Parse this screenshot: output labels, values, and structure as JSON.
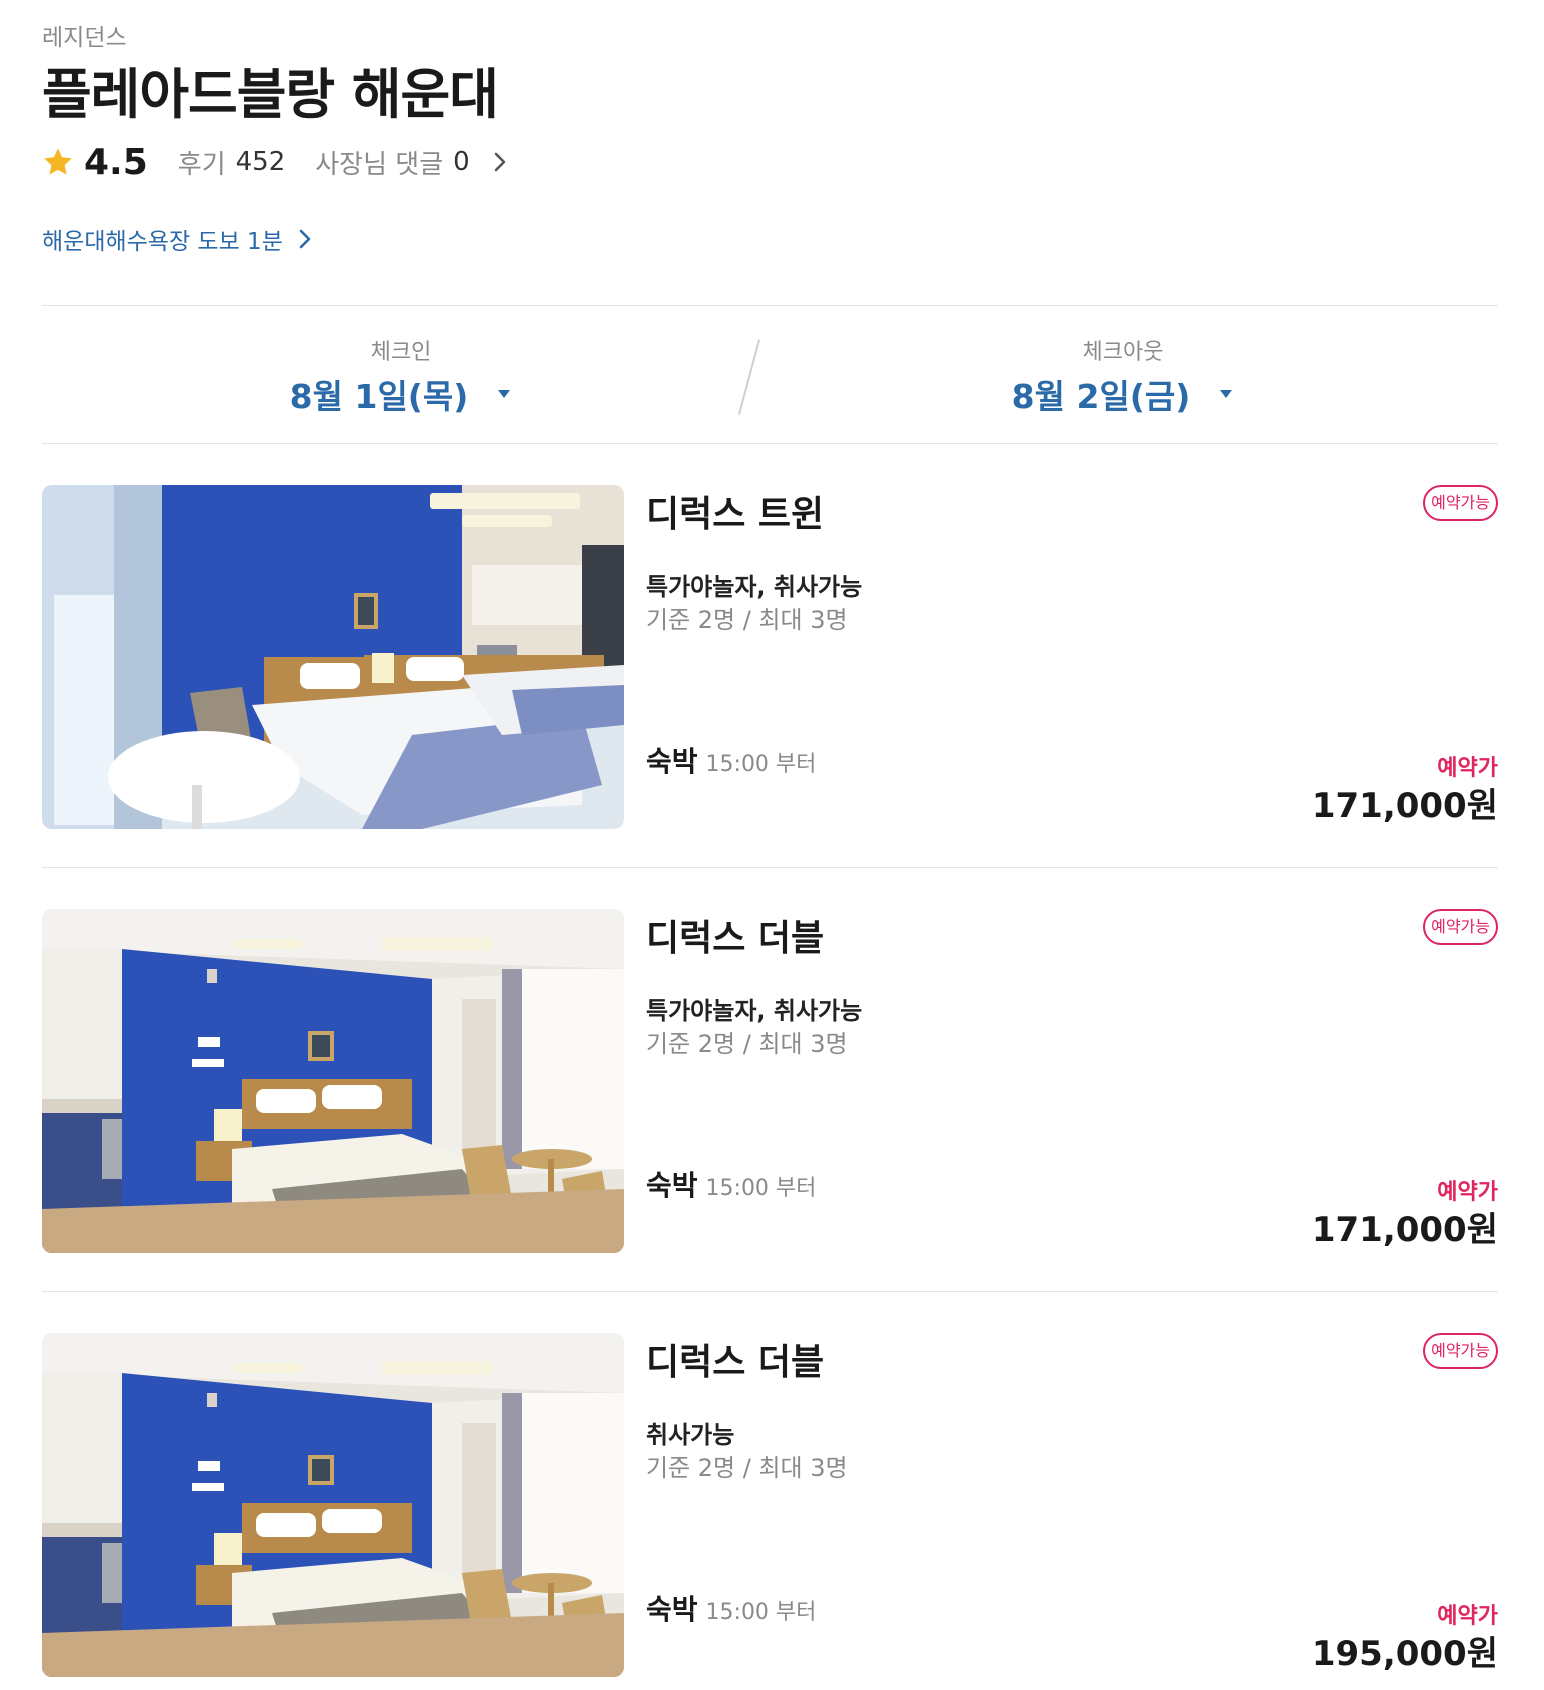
{
  "header": {
    "category": "레지던스",
    "title": "플레아드블랑 해운대",
    "rating": "4.5",
    "review_label": "후기",
    "review_count": "452",
    "owner_reply_label": "사장님 댓글",
    "owner_reply_count": "0",
    "location": "해운대해수욕장 도보 1분"
  },
  "dates": {
    "checkin_label": "체크인",
    "checkin_value": "8월 1일(목)",
    "checkout_label": "체크아웃",
    "checkout_value": "8월 2일(금)"
  },
  "rooms": [
    {
      "name": "디럭스 트윈",
      "badge": "예약가능",
      "features": "특가야놀자, 취사가능",
      "capacity": "기준 2명 / 최대 3명",
      "stay_type": "숙박",
      "stay_time": "15:00 부터",
      "price_label": "예약가",
      "price": "171,000원"
    },
    {
      "name": "디럭스 더블",
      "badge": "예약가능",
      "features": "특가야놀자, 취사가능",
      "capacity": "기준 2명 / 최대 3명",
      "stay_type": "숙박",
      "stay_time": "15:00 부터",
      "price_label": "예약가",
      "price": "171,000원"
    },
    {
      "name": "디럭스 더블",
      "badge": "예약가능",
      "features": "취사가능",
      "capacity": "기준 2명 / 최대 3명",
      "stay_type": "숙박",
      "stay_time": "15:00 부터",
      "price_label": "예약가",
      "price": "195,000원"
    }
  ],
  "icons": {
    "rating": "star-icon",
    "link": "chevron-right-icon",
    "date_dropdown": "caret-down-icon"
  },
  "colors": {
    "accent_blue": "#2b6aa8",
    "accent_red": "#e0245e",
    "star": "#f5b623",
    "wall_blue": "#2c52b8"
  }
}
